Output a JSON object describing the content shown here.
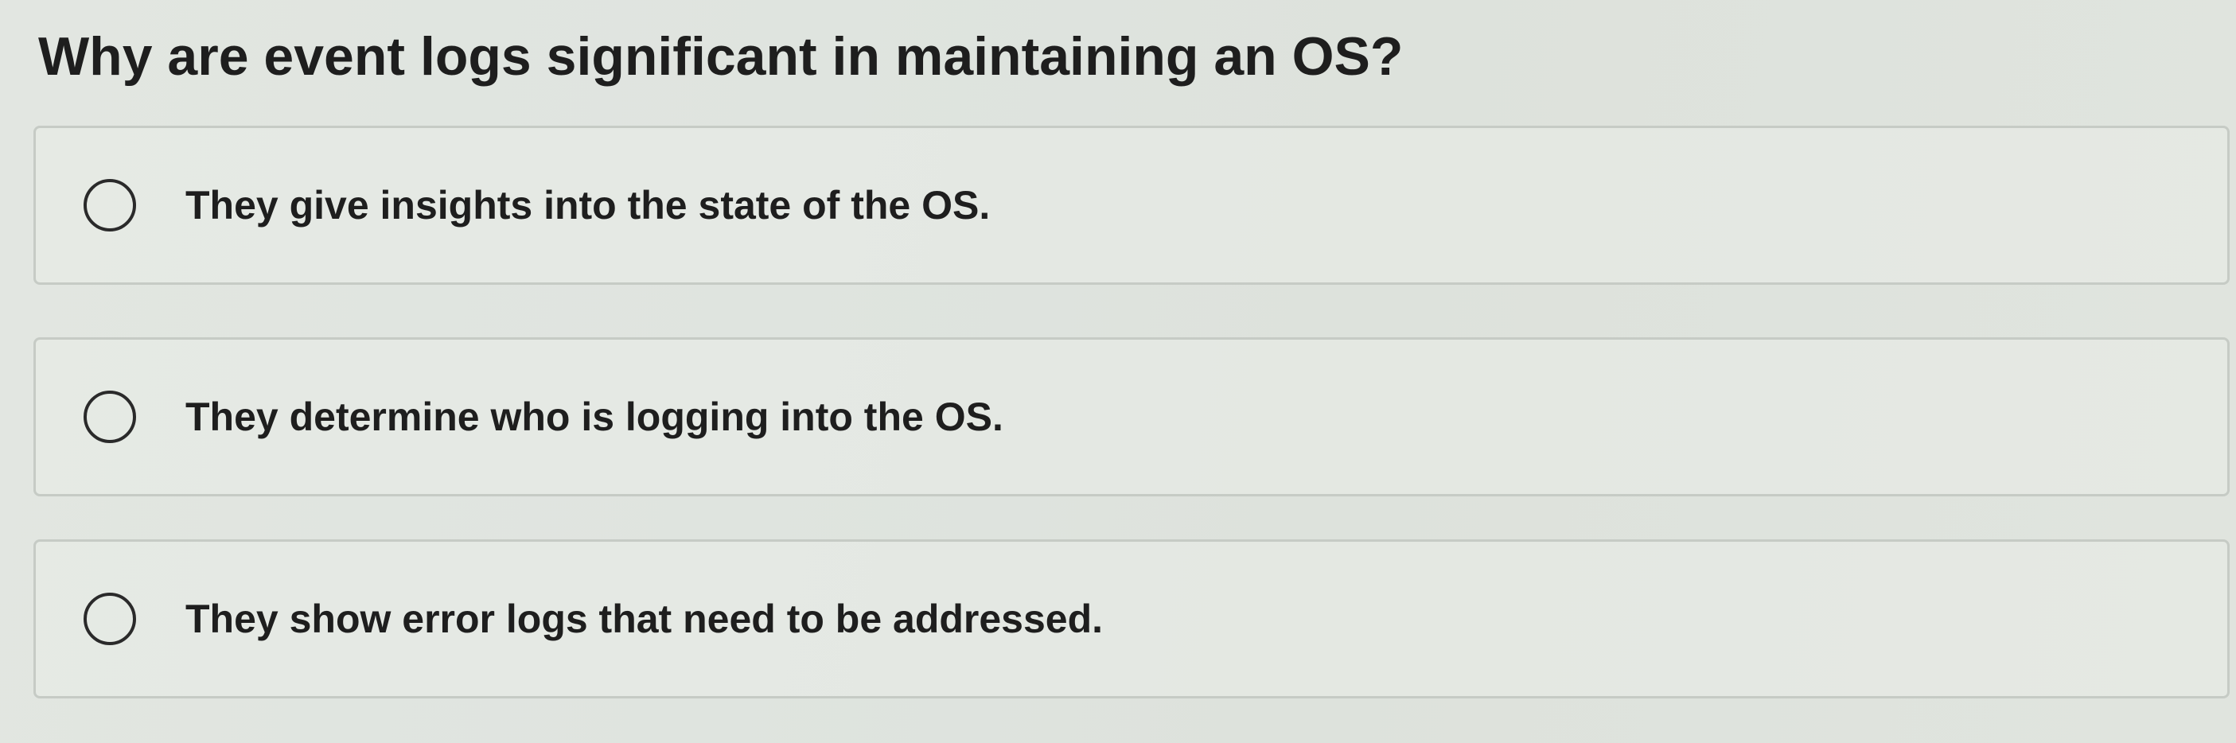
{
  "question": {
    "text": "Why are event logs significant in maintaining an OS?"
  },
  "options": [
    {
      "label": "They give insights into the state of the OS.",
      "selected": false
    },
    {
      "label": "They determine who is logging into the OS.",
      "selected": false
    },
    {
      "label": "They show error logs that need to be addressed.",
      "selected": false
    }
  ]
}
